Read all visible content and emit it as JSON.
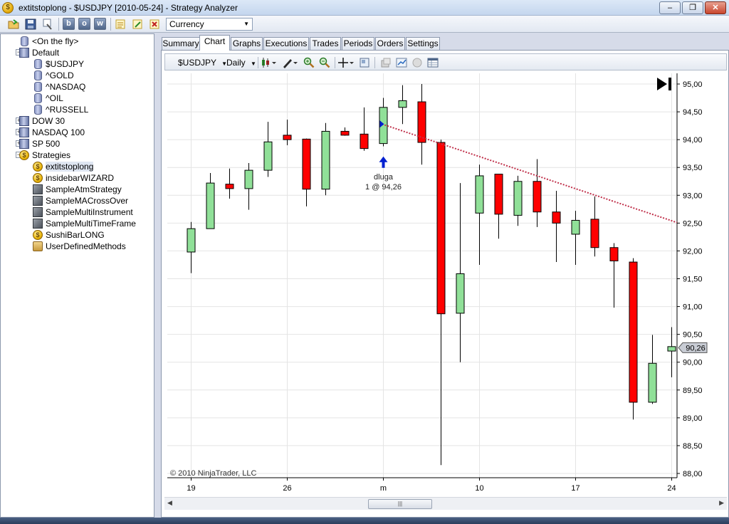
{
  "window": {
    "title": "extitstoplong - $USDJPY [2010-05-24] - Strategy Analyzer",
    "minimize_label": "–",
    "maximize_label": "❐",
    "close_label": "✕"
  },
  "toolbar": {
    "letter_buttons": [
      "b",
      "o",
      "w"
    ],
    "currency_value": "Currency"
  },
  "tree": {
    "items": [
      {
        "label": "<On the fly>",
        "icon": "database-icon"
      },
      {
        "label": "Default",
        "icon": "database-group-icon",
        "expander": "−"
      },
      {
        "label": "$USDJPY",
        "icon": "database-icon"
      },
      {
        "label": "^GOLD",
        "icon": "database-icon"
      },
      {
        "label": "^NASDAQ",
        "icon": "database-icon"
      },
      {
        "label": "^OIL",
        "icon": "database-icon"
      },
      {
        "label": "^RUSSELL",
        "icon": "database-icon"
      },
      {
        "label": "DOW 30",
        "icon": "database-group-icon",
        "expander": "+"
      },
      {
        "label": "NASDAQ 100",
        "icon": "database-group-icon",
        "expander": "+"
      },
      {
        "label": "SP 500",
        "icon": "database-group-icon",
        "expander": "+"
      },
      {
        "label": "Strategies",
        "icon": "coin-icon",
        "expander": "−"
      },
      {
        "label": "extitstoplong",
        "icon": "coin-icon",
        "selected": true
      },
      {
        "label": "insidebarWIZARD",
        "icon": "coin-icon"
      },
      {
        "label": "SampleAtmStrategy",
        "icon": "cube-icon"
      },
      {
        "label": "SampleMACrossOver",
        "icon": "cube-icon"
      },
      {
        "label": "SampleMultiInstrument",
        "icon": "cube-icon"
      },
      {
        "label": "SampleMultiTimeFrame",
        "icon": "cube-icon"
      },
      {
        "label": "SushiBarLONG",
        "icon": "coin-icon"
      },
      {
        "label": "UserDefinedMethods",
        "icon": "folder-icon"
      }
    ]
  },
  "tabs": [
    "Summary",
    "Chart",
    "Graphs",
    "Executions",
    "Trades",
    "Periods",
    "Orders",
    "Settings"
  ],
  "active_tab": "Chart",
  "chart_toolbar": {
    "instrument": "$USDJPY",
    "period": "Daily"
  },
  "chart": {
    "copyright": "© 2010 NinjaTrader, LLC",
    "trade_label": "dluga",
    "trade_fill": "1 @ 94,26",
    "last_price_tag": "90,26",
    "colors": {
      "up": "#90e098",
      "down": "#ff0000",
      "trendline": "#c0304a",
      "marker": "#0020d0"
    }
  },
  "chart_data": {
    "type": "candlestick",
    "x_ticks": [
      "19",
      "26",
      "m",
      "10",
      "17",
      "24"
    ],
    "y_ticks": [
      "95,00",
      "94,50",
      "94,00",
      "93,50",
      "93,00",
      "92,50",
      "92,00",
      "91,50",
      "91,00",
      "90,50",
      "90,00",
      "89,50",
      "89,00",
      "88,50",
      "88,00"
    ],
    "ylim": [
      88.0,
      95.0
    ],
    "grid": true,
    "candles": [
      {
        "o": 91.98,
        "h": 92.52,
        "l": 91.6,
        "c": 92.4
      },
      {
        "o": 92.4,
        "h": 93.4,
        "l": 92.4,
        "c": 93.22
      },
      {
        "o": 93.2,
        "h": 93.48,
        "l": 92.94,
        "c": 93.12
      },
      {
        "o": 93.12,
        "h": 93.58,
        "l": 92.74,
        "c": 93.45
      },
      {
        "o": 93.45,
        "h": 94.32,
        "l": 93.33,
        "c": 93.96
      },
      {
        "o": 94.08,
        "h": 94.36,
        "l": 93.9,
        "c": 94.0
      },
      {
        "o": 94.01,
        "h": 94.02,
        "l": 92.8,
        "c": 93.11
      },
      {
        "o": 93.11,
        "h": 94.3,
        "l": 93.0,
        "c": 94.15
      },
      {
        "o": 94.15,
        "h": 94.22,
        "l": 94.07,
        "c": 94.08
      },
      {
        "o": 94.1,
        "h": 94.58,
        "l": 93.8,
        "c": 93.84
      },
      {
        "o": 93.93,
        "h": 94.75,
        "l": 93.88,
        "c": 94.58
      },
      {
        "o": 94.58,
        "h": 94.98,
        "l": 94.28,
        "c": 94.7
      },
      {
        "o": 94.68,
        "h": 95.0,
        "l": 93.55,
        "c": 93.95
      },
      {
        "o": 93.95,
        "h": 94.0,
        "l": 88.15,
        "c": 90.87
      },
      {
        "o": 90.88,
        "h": 93.22,
        "l": 90.0,
        "c": 91.59
      },
      {
        "o": 92.68,
        "h": 93.55,
        "l": 91.75,
        "c": 93.35
      },
      {
        "o": 93.38,
        "h": 93.38,
        "l": 92.22,
        "c": 92.66
      },
      {
        "o": 92.64,
        "h": 93.35,
        "l": 92.45,
        "c": 93.25
      },
      {
        "o": 93.25,
        "h": 93.65,
        "l": 92.43,
        "c": 92.7
      },
      {
        "o": 92.7,
        "h": 93.08,
        "l": 91.8,
        "c": 92.5
      },
      {
        "o": 92.3,
        "h": 92.72,
        "l": 91.75,
        "c": 92.55
      },
      {
        "o": 92.57,
        "h": 92.98,
        "l": 91.9,
        "c": 92.06
      },
      {
        "o": 92.06,
        "h": 92.14,
        "l": 90.98,
        "c": 91.82
      },
      {
        "o": 91.8,
        "h": 91.87,
        "l": 88.97,
        "c": 89.28
      },
      {
        "o": 89.28,
        "h": 90.49,
        "l": 89.25,
        "c": 89.98
      },
      {
        "o": 90.2,
        "h": 90.63,
        "l": 89.73,
        "c": 90.28
      }
    ]
  }
}
